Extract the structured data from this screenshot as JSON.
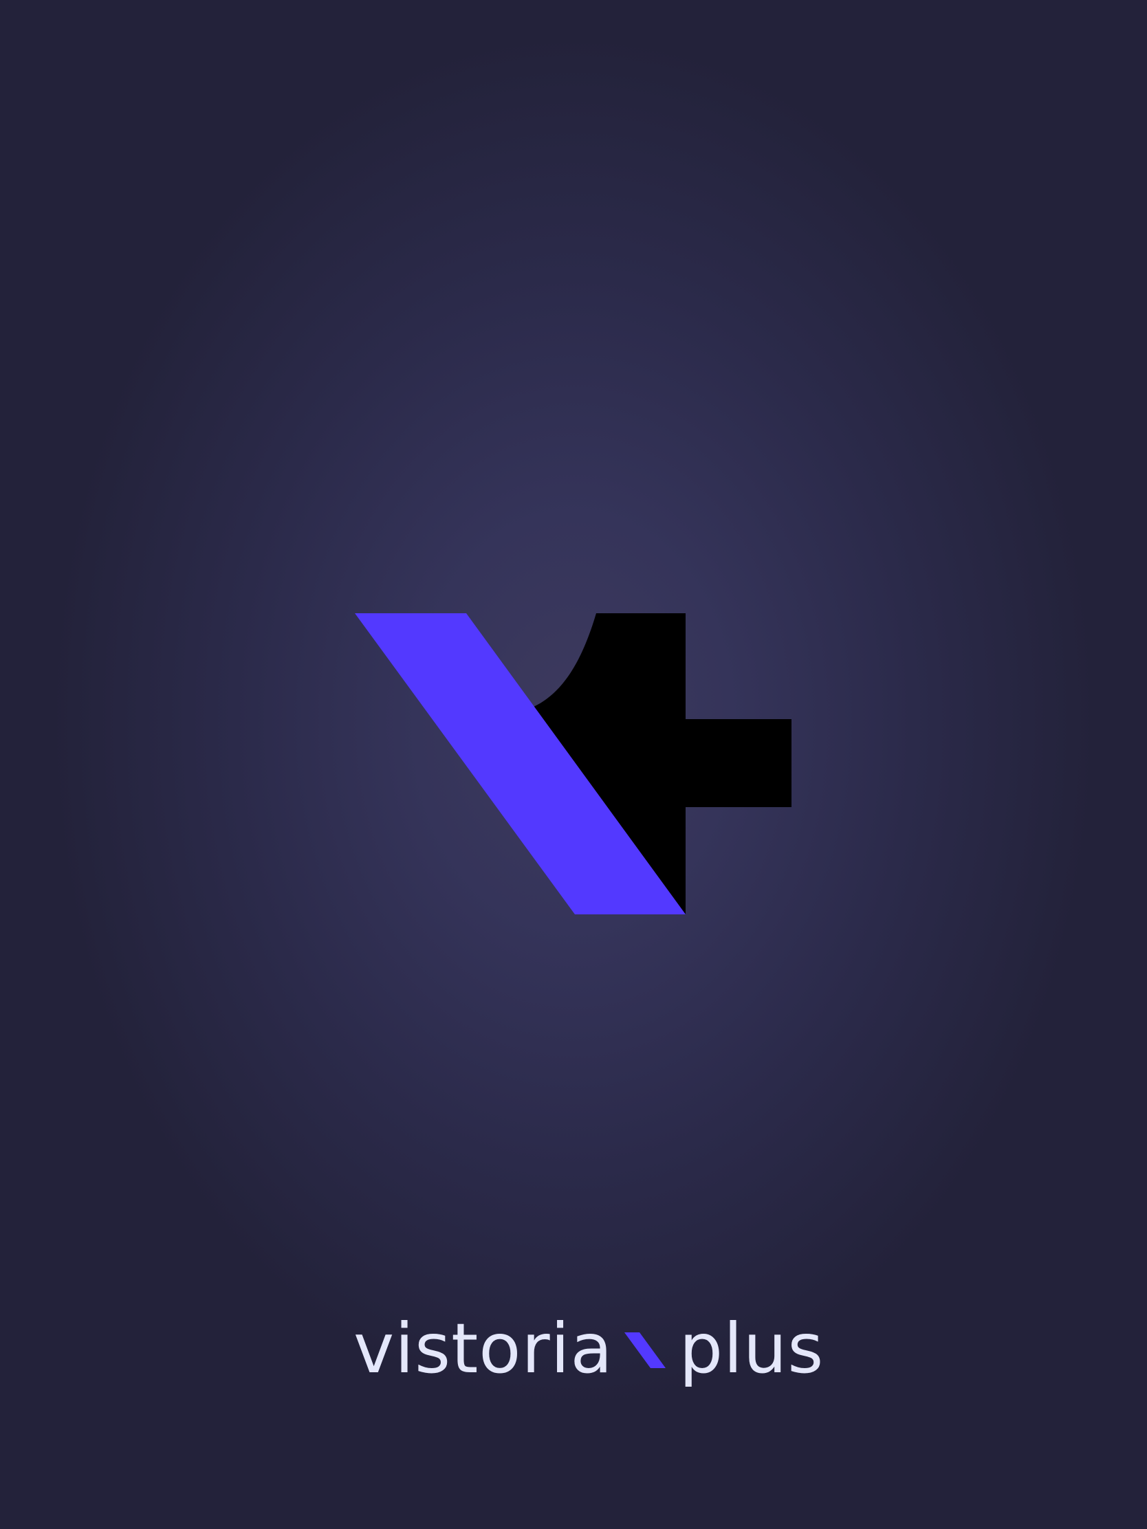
{
  "screen": "splash",
  "brand": {
    "name_left": "vistoria",
    "name_right": "plus",
    "accent_color": "#5339ff",
    "mark_color": "#000000",
    "text_color": "#e4e7fa"
  },
  "background": {
    "center_color": "#3d3a5e",
    "edge_color": "#23223a"
  },
  "icons": {
    "logo_mark": "vistoria-plus-logo-icon",
    "wordmark_separator": "slash-accent-icon"
  }
}
